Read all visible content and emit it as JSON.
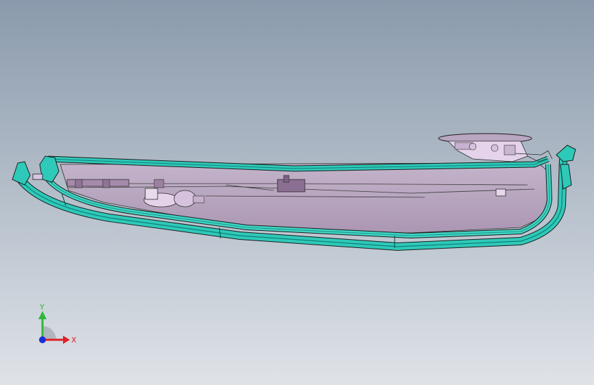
{
  "viewport": {
    "background_top": "#8a9aac",
    "background_bottom": "#dfe3e8"
  },
  "model": {
    "body_color": "#b49ab8",
    "edge_color": "#1a1a1a",
    "seal_color": "#2ec9b9",
    "seal_dark": "#0e7e74",
    "bracket_color": "#d9c6e2"
  },
  "triad": {
    "x_label": "X",
    "y_label": "Y",
    "x_color": "#e0202a",
    "y_color": "#2fb83a",
    "z_color": "#1a2ed8"
  }
}
